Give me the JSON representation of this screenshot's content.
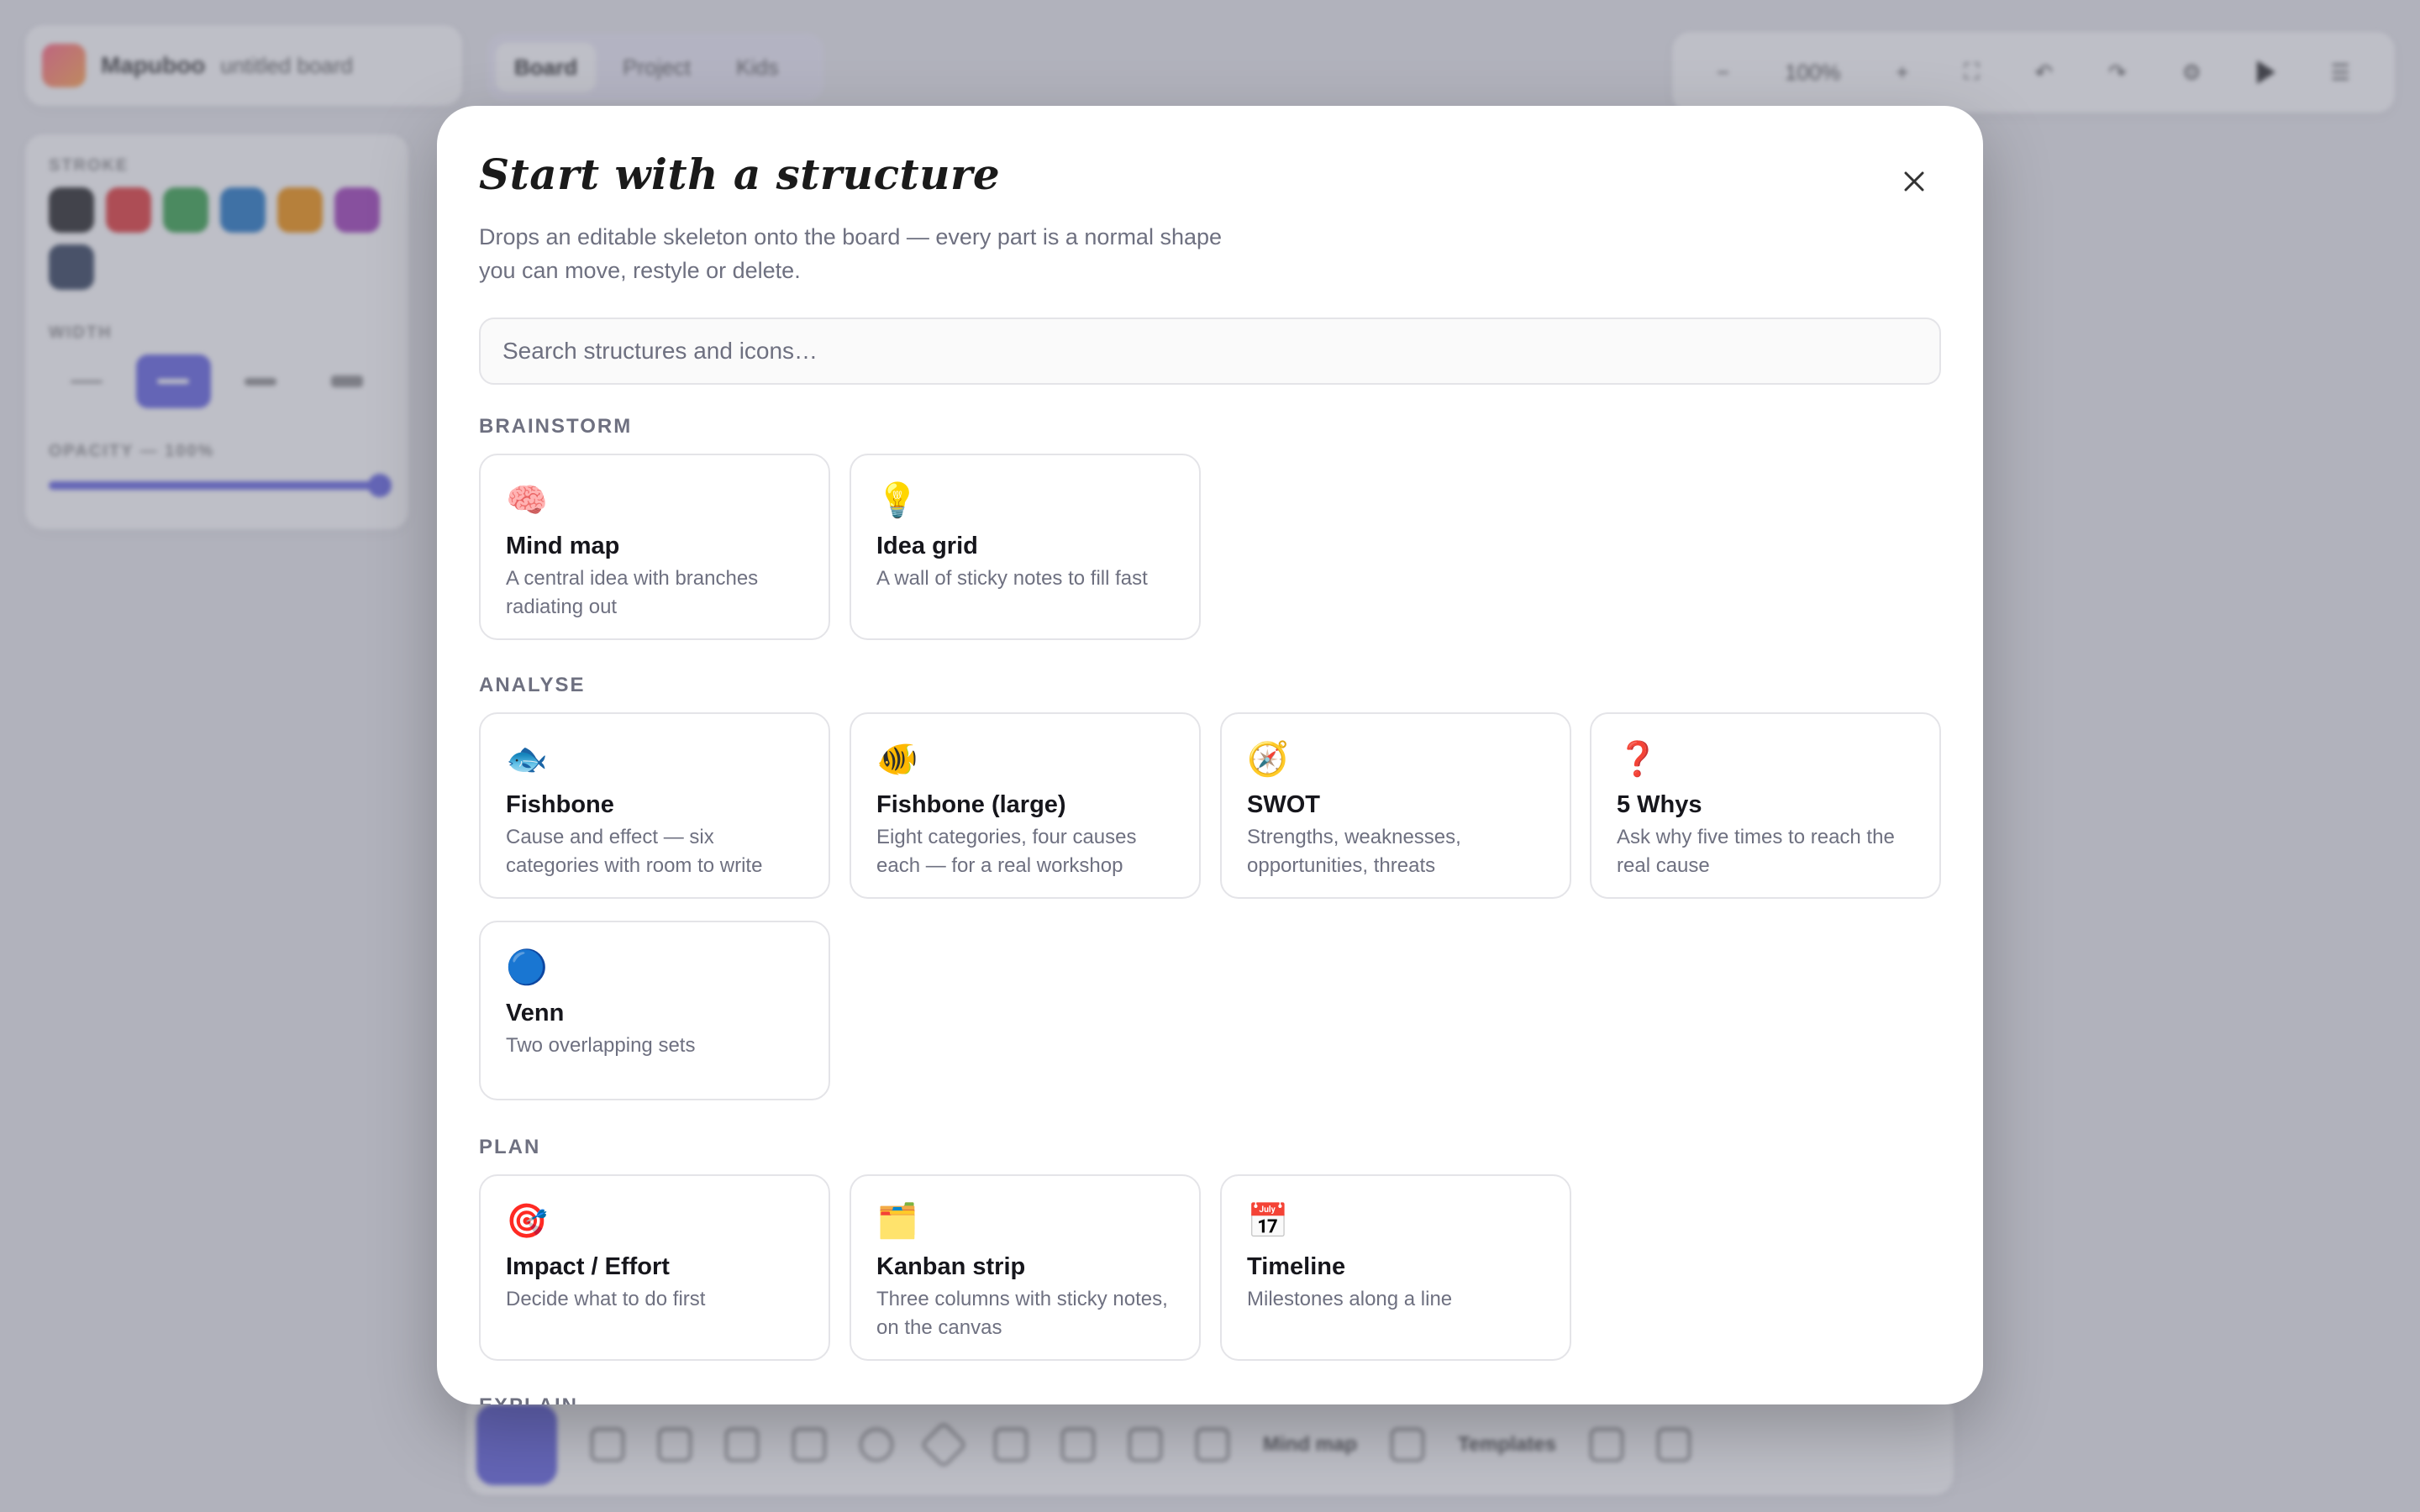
{
  "app": {
    "brand": "Mapuboo",
    "board_name": "untitled board",
    "mode_tabs": [
      "Board",
      "Project",
      "Kids"
    ],
    "zoom": "100%",
    "panel": {
      "stroke_label": "STROKE",
      "width_label": "WIDTH",
      "opacity_label": "OPACITY — 100%",
      "opacity_value": 1.0,
      "swatch_colors": [
        "#1e1e1e",
        "#e03131",
        "#2f9e44",
        "#1971c2",
        "#f08c00",
        "#9c36b5",
        "#2b3a55"
      ]
    },
    "bottom_toolbar": {
      "mindmap_label": "Mind map",
      "templates_label": "Templates"
    }
  },
  "modal": {
    "title": "Start with a structure",
    "subtitle": "Drops an editable skeleton onto the board — every part is a normal shape you can move, restyle or delete.",
    "search_placeholder": "Search structures and icons…",
    "sections": [
      {
        "label": "BRAINSTORM",
        "cards": [
          {
            "icon": "🧠",
            "icon_name": "brain-icon",
            "title": "Mind map",
            "desc": "A central idea with branches radiating out"
          },
          {
            "icon": "💡",
            "icon_name": "lightbulb-icon",
            "title": "Idea grid",
            "desc": "A wall of sticky notes to fill fast"
          }
        ]
      },
      {
        "label": "ANALYSE",
        "cards": [
          {
            "icon": "🐟",
            "icon_name": "fish-icon",
            "title": "Fishbone",
            "desc": "Cause and effect — six categories with room to write"
          },
          {
            "icon": "🐠",
            "icon_name": "tropical-fish-icon",
            "title": "Fishbone (large)",
            "desc": "Eight categories, four causes each — for a real workshop"
          },
          {
            "icon": "🧭",
            "icon_name": "compass-icon",
            "title": "SWOT",
            "desc": "Strengths, weaknesses, opportunities, threats"
          },
          {
            "icon": "❓",
            "icon_name": "question-mark-icon",
            "title": "5 Whys",
            "desc": "Ask why five times to reach the real cause"
          },
          {
            "icon": "🔵",
            "icon_name": "blue-circle-icon",
            "title": "Venn",
            "desc": "Two overlapping sets"
          }
        ]
      },
      {
        "label": "PLAN",
        "cards": [
          {
            "icon": "🎯",
            "icon_name": "target-icon",
            "title": "Impact / Effort",
            "desc": "Decide what to do first"
          },
          {
            "icon": "🗂️",
            "icon_name": "card-index-icon",
            "title": "Kanban strip",
            "desc": "Three columns with sticky notes, on the canvas"
          },
          {
            "icon": "📅",
            "icon_name": "calendar-icon",
            "title": "Timeline",
            "desc": "Milestones along a line"
          }
        ]
      },
      {
        "label": "EXPLAIN",
        "cards": []
      }
    ]
  }
}
